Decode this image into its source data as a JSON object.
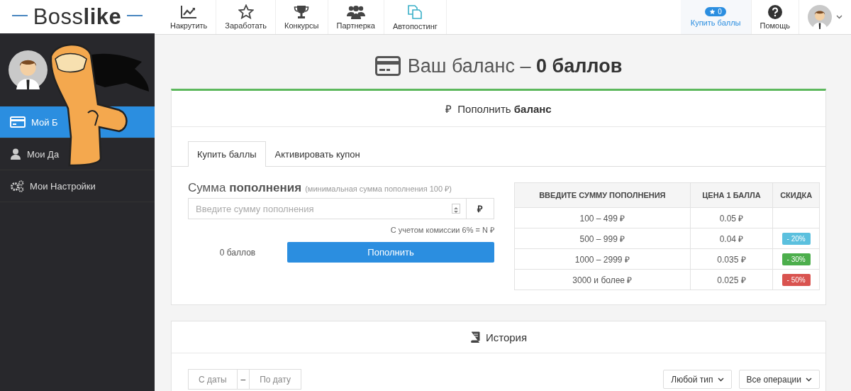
{
  "logo": "Boss**like**",
  "nav": [
    {
      "label": "Накрутить"
    },
    {
      "label": "Заработать"
    },
    {
      "label": "Конкурсы"
    },
    {
      "label": "Партнерка"
    },
    {
      "label": "Автопостинг"
    }
  ],
  "buy_points": {
    "badge": "0",
    "label": "Купить баллы"
  },
  "help": {
    "label": "Помощь"
  },
  "sidebar": {
    "items": [
      {
        "label": "Мой Б",
        "selected": true
      },
      {
        "label": "Мои Да",
        "selected": false
      },
      {
        "label": "Мои Настройки",
        "selected": false
      }
    ]
  },
  "page_title": "Ваш баланс – **0 баллов**",
  "topup": {
    "heading_icon": "₽",
    "heading": "Пополнить **баланс**",
    "tabs": [
      {
        "label": "Купить баллы",
        "selected": true
      },
      {
        "label": "Активировать купон",
        "selected": false
      }
    ],
    "amount_label": "Сумма **пополнения**",
    "amount_hint": "(минимальная сумма пополнения 100 ₽)",
    "placeholder": "Введите сумму пополнения",
    "currency": "₽",
    "commission": "С учетом комиссии 6% = N ₽",
    "points": "0 баллов",
    "submit": "Пополнить"
  },
  "price_table": {
    "columns": [
      "ВВЕДИТЕ СУММУ ПОПОЛНЕНИЯ",
      "ЦЕНА 1 БАЛЛА",
      "СКИДКА"
    ],
    "rows": [
      {
        "range": "100 – 499 ₽",
        "price": "0.05 ₽"
      },
      {
        "range": "500 – 999 ₽",
        "price": "0.04 ₽",
        "discount": "- 20%",
        "color": "#5bc0de"
      },
      {
        "range": "1000 – 2999 ₽",
        "price": "0.035 ₽",
        "discount": "- 30%",
        "color": "#4cae4c"
      },
      {
        "range": "3000 и более ₽",
        "price": "0.025 ₽",
        "discount": "- 50%",
        "color": "#d9534f"
      }
    ]
  },
  "history": {
    "heading": "История",
    "date_from": "С даты",
    "dash": "–",
    "date_to": "По дату",
    "type_filter": "Любой тип",
    "ops_filter": "Все операции"
  }
}
